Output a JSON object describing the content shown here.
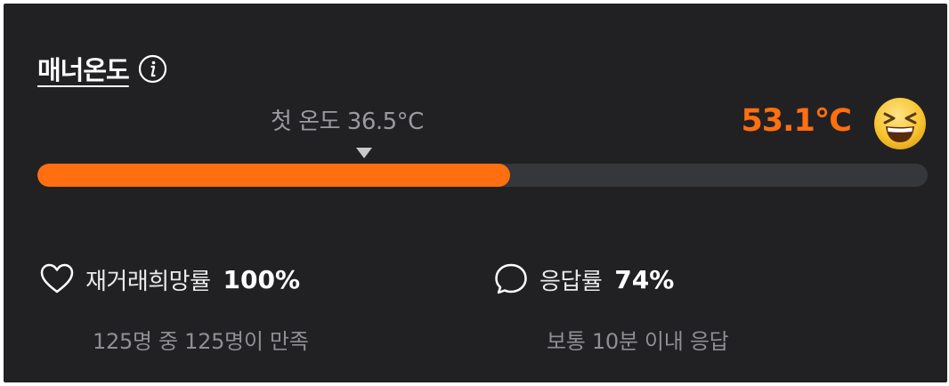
{
  "manner_temperature": {
    "title": "매너온도",
    "first_temp_label": "첫 온도 36.5°C",
    "current_temp": "53.1°C",
    "progress_fraction": 0.531,
    "accent_color": "#ff6f0f",
    "info_icon": "info-icon",
    "emoji": "laughing-face-emoji"
  },
  "stats": {
    "rehire": {
      "icon": "heart-icon",
      "label": "재거래희망률",
      "value": "100%",
      "sub": "125명 중 125명이 만족"
    },
    "response": {
      "icon": "speech-bubble-icon",
      "label": "응답률",
      "value": "74%",
      "sub": "보통 10분 이내 응답"
    }
  }
}
